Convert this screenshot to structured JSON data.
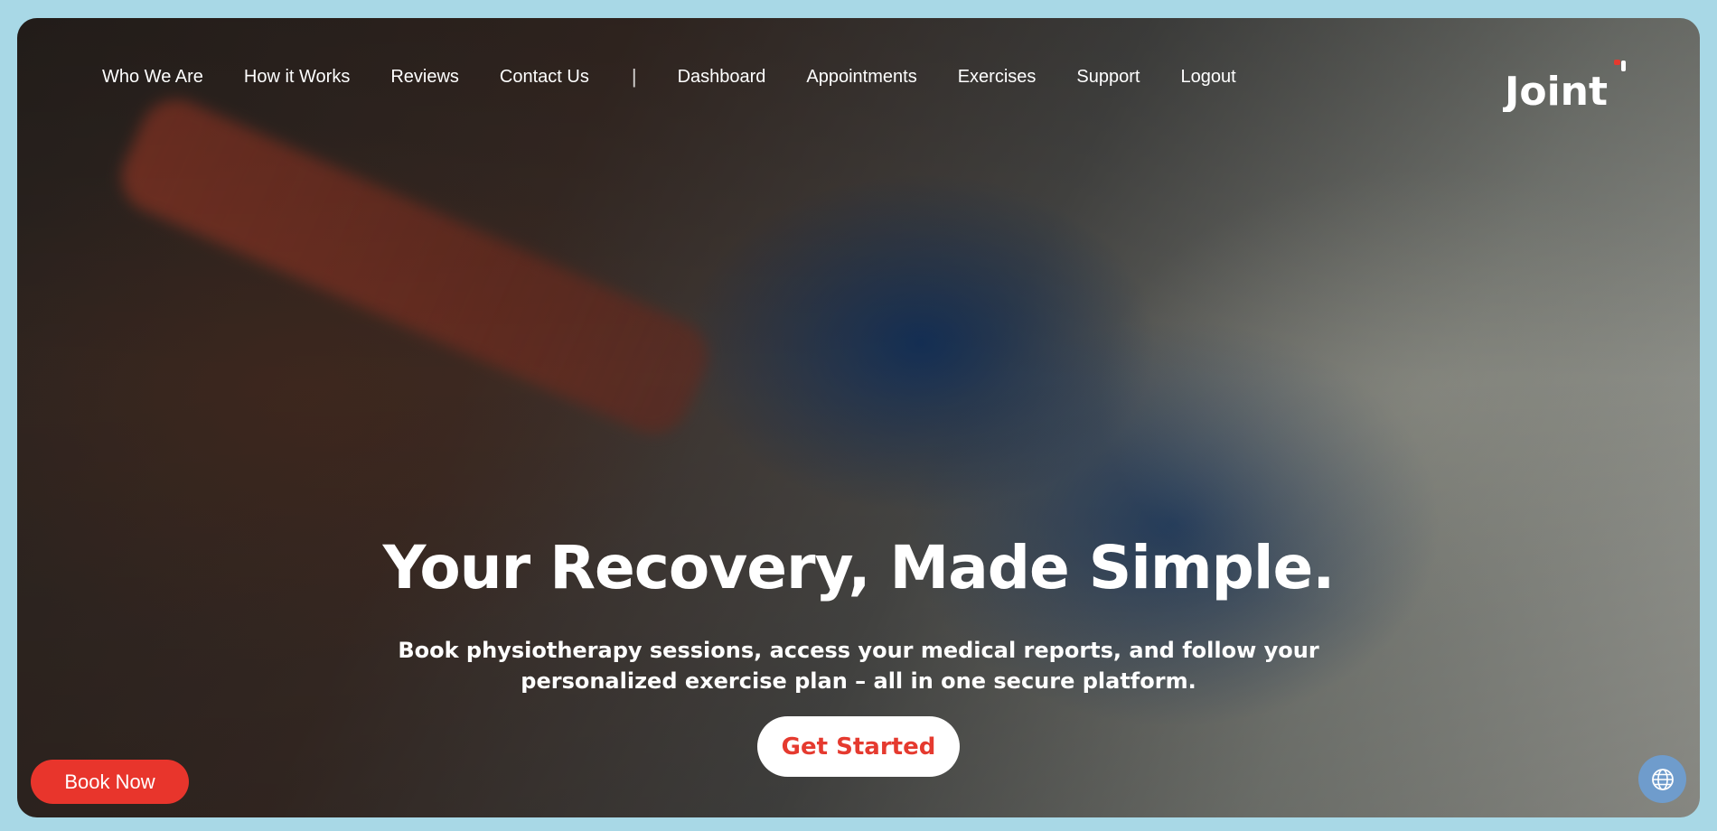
{
  "nav": {
    "items": [
      {
        "label": "Who We Are"
      },
      {
        "label": "How it Works"
      },
      {
        "label": "Reviews"
      },
      {
        "label": "Contact Us"
      }
    ],
    "separator": "|",
    "account_items": [
      {
        "label": "Dashboard"
      },
      {
        "label": "Appointments"
      },
      {
        "label": "Exercises"
      },
      {
        "label": "Support"
      },
      {
        "label": "Logout"
      }
    ]
  },
  "logo": {
    "text": "Joint",
    "accent_color": "#e53a2f"
  },
  "hero": {
    "headline": "Your Recovery, Made Simple.",
    "subheadline": "Book physiotherapy sessions, access your medical reports, and follow your personalized exercise plan – all in one secure platform.",
    "cta_label": "Get Started"
  },
  "floating": {
    "book_now_label": "Book Now",
    "language_icon": "globe-icon"
  },
  "colors": {
    "page_background": "#a8d8e6",
    "brand_red": "#e53a2f",
    "globe_button": "#6f9ccc"
  }
}
